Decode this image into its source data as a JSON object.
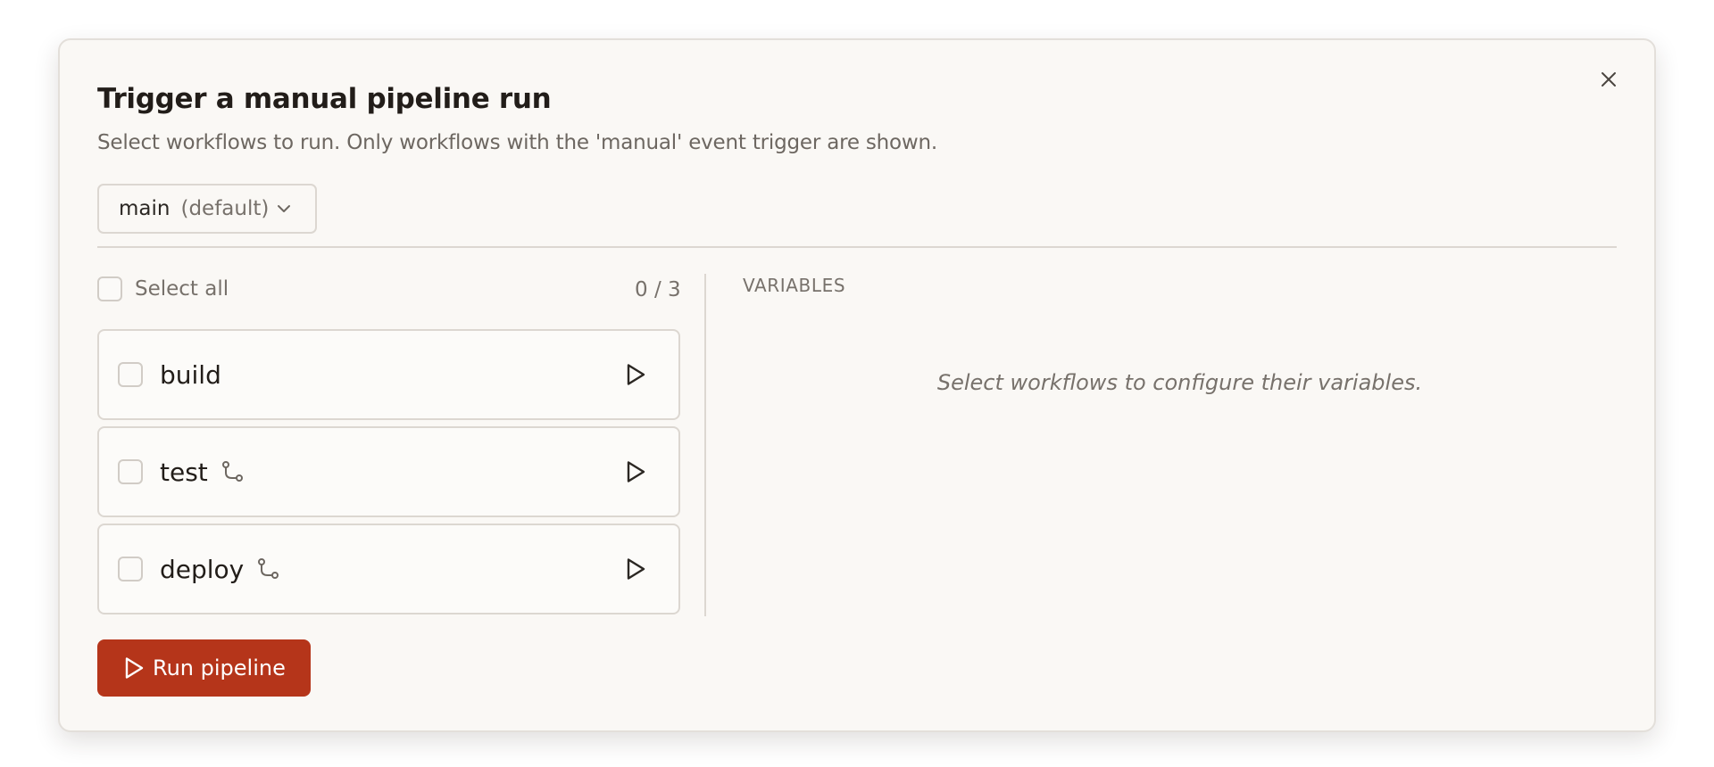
{
  "dialog": {
    "title": "Trigger a manual pipeline run",
    "subtitle": "Select workflows to run. Only workflows with the 'manual' event trigger are shown.",
    "close_icon": "close-icon"
  },
  "branch": {
    "name": "main",
    "suffix": "(default)",
    "icon": "chevron-down-icon"
  },
  "workflows_panel": {
    "select_all_label": "Select all",
    "select_all_checked": false,
    "count": "0 / 3",
    "items": [
      {
        "name": "build",
        "checked": false,
        "has_branch_icon": false,
        "icon": "play-icon"
      },
      {
        "name": "test",
        "checked": false,
        "has_branch_icon": true,
        "icon": "play-icon"
      },
      {
        "name": "deploy",
        "checked": false,
        "has_branch_icon": true,
        "icon": "play-icon"
      }
    ]
  },
  "variables_panel": {
    "label": "VARIABLES",
    "empty_message": "Select workflows to configure their variables."
  },
  "footer": {
    "run_label": "Run pipeline",
    "run_icon": "play-icon"
  },
  "colors": {
    "accent": "#b5351a",
    "background": "#faf8f5",
    "border": "#dcd7d1",
    "muted_text": "#77716b"
  }
}
